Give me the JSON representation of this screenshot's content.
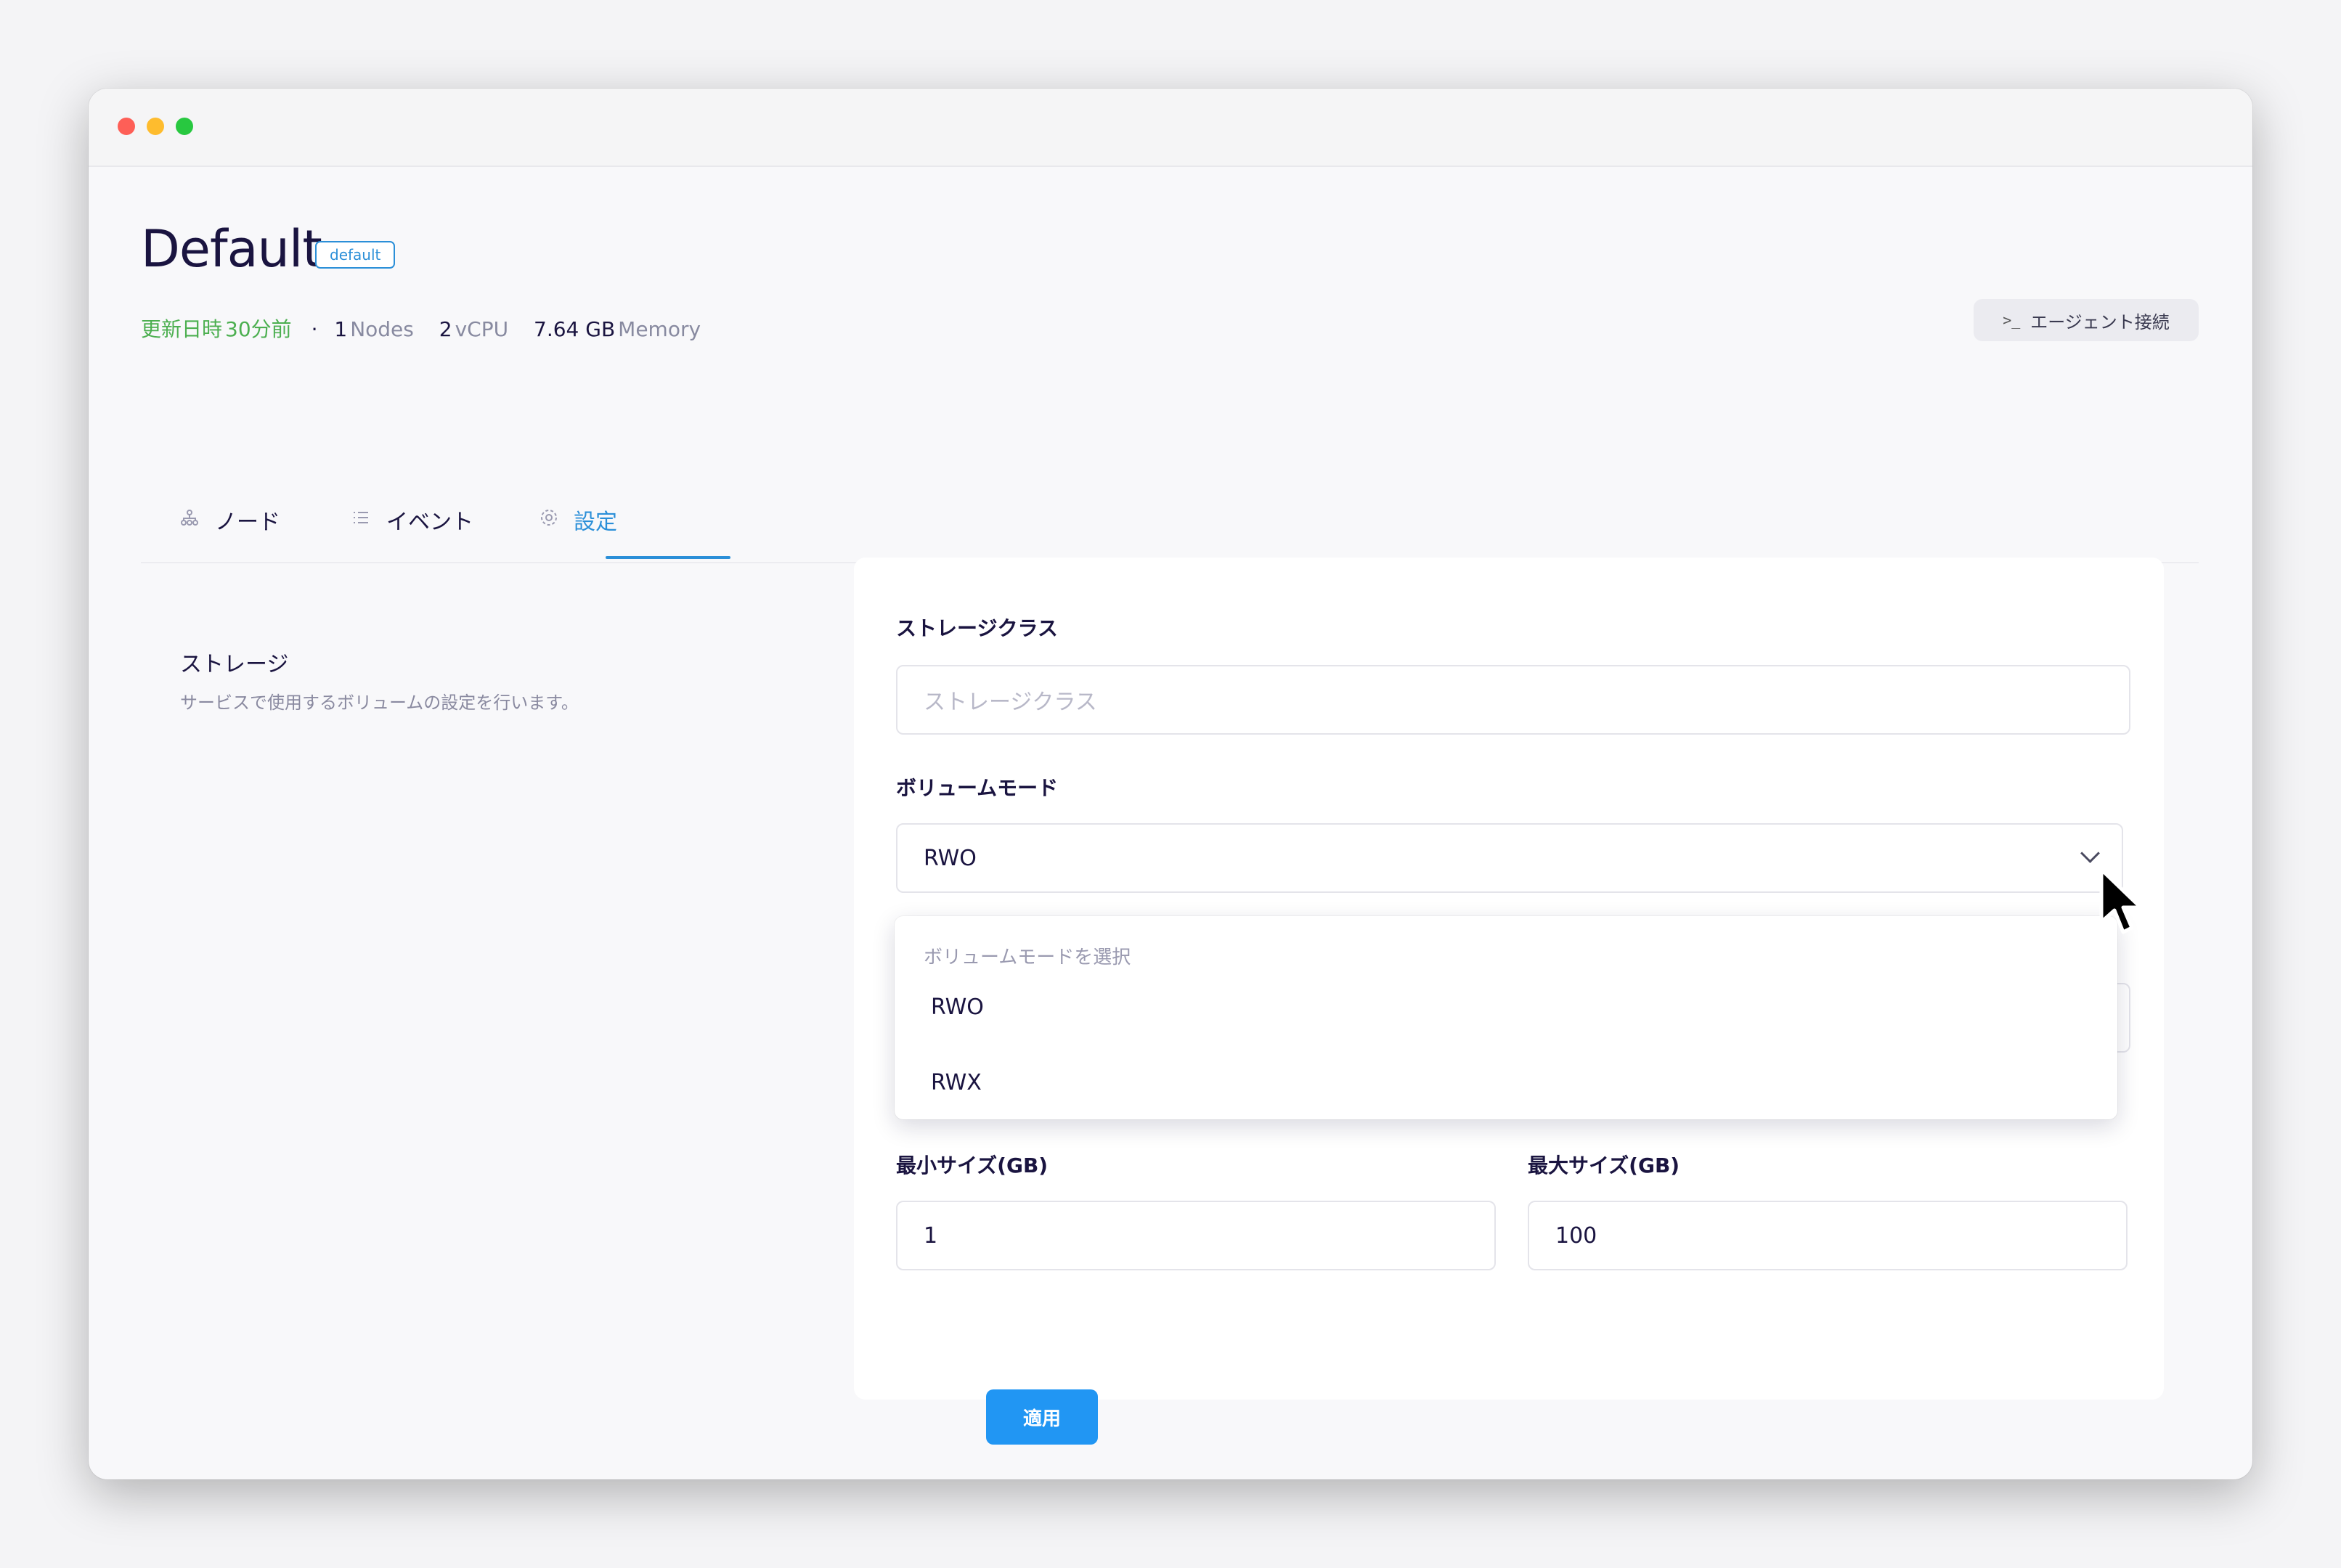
{
  "header": {
    "title": "Default",
    "badge": "default",
    "meta": {
      "updated_label": "更新日時",
      "updated_value": "30分前",
      "separator": "·",
      "nodes_count": "1",
      "nodes_label": "Nodes",
      "vcpu_count": "2",
      "vcpu_label": "vCPU",
      "memory_value": "7.64 GB",
      "memory_label": "Memory"
    },
    "agent_button": {
      "icon": "terminal-icon",
      "icon_glyph": ">_",
      "label": "エージェント接続"
    }
  },
  "tabs": [
    {
      "label": "ノード",
      "icon": "nodes-icon",
      "active": false
    },
    {
      "label": "イベント",
      "icon": "list-icon",
      "active": false
    },
    {
      "label": "設定",
      "icon": "gear-icon",
      "active": true
    }
  ],
  "section": {
    "title": "ストレージ",
    "description": "サービスで使用するボリュームの設定を行います。"
  },
  "form": {
    "storage_class": {
      "label": "ストレージクラス",
      "placeholder": "ストレージクラス",
      "value": ""
    },
    "volume_mode": {
      "label": "ボリュームモード",
      "selected": "RWO",
      "dropdown_header": "ボリュームモードを選択",
      "options": [
        "RWO",
        "RWX"
      ]
    },
    "min_size": {
      "label": "最小サイズ(GB)",
      "value": "1"
    },
    "max_size": {
      "label": "最大サイズ(GB)",
      "value": "100"
    },
    "apply_label": "適用"
  },
  "colors": {
    "accent": "#2196f3",
    "tab_active": "#2b8fd8",
    "updated": "#4caf50",
    "title": "#1a1440"
  }
}
